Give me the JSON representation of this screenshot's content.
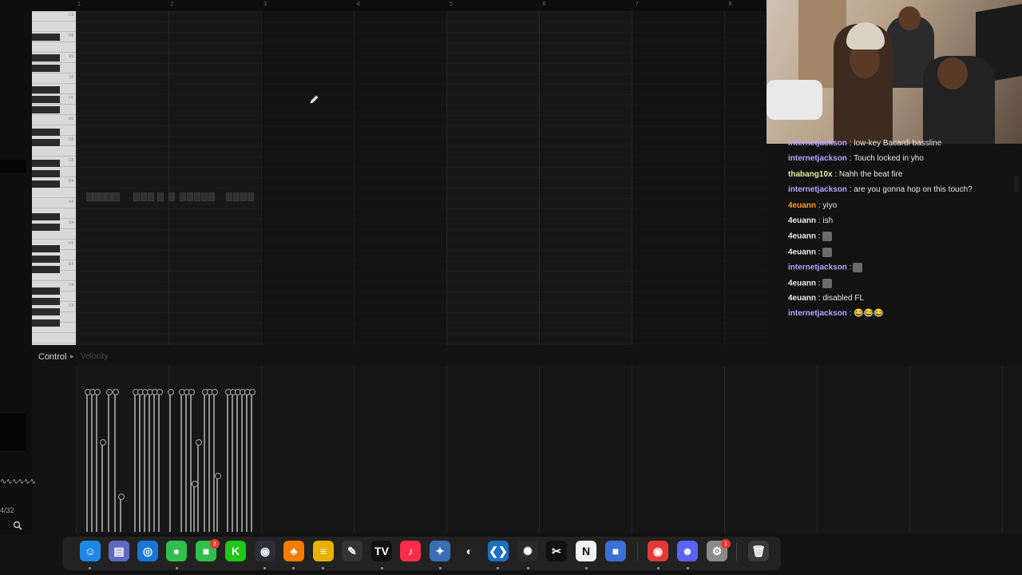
{
  "ruler": {
    "bars": [
      "1",
      "2",
      "3",
      "4",
      "5",
      "6",
      "7",
      "8"
    ]
  },
  "keyboard": {
    "labels": [
      "C6",
      "B5",
      "A5",
      "G5",
      "F5",
      "E5",
      "D5",
      "C5",
      "B4",
      "A4",
      "G4",
      "F4",
      "E4",
      "D4",
      "C4"
    ]
  },
  "control": {
    "label": "Control",
    "velocity_label": "Velocity"
  },
  "left_rail": {
    "time_signature": "4/32"
  },
  "chat": {
    "messages": [
      {
        "user": "internetjackson",
        "user_color": "#b9a6ff",
        "text": ": low-key Bacardi bassline"
      },
      {
        "user": "internetjackson",
        "user_color": "#b9a6ff",
        "text": ": Touch locked in yho"
      },
      {
        "user": "thabang10x",
        "user_color": "#d7f2a0",
        "text": ": Nahh the beat fire"
      },
      {
        "user": "internetjackson",
        "user_color": "#b9a6ff",
        "text": ": are you gonna hop on this touch?"
      },
      {
        "user": "4euann",
        "user_color": "#ff9f1a",
        "text": ": yiyo"
      },
      {
        "user": "4euann",
        "user_color": "#e9e9e9",
        "text": ": ish"
      },
      {
        "user": "4euann",
        "user_color": "#e9e9e9",
        "text": ":",
        "emote": "emote-icon"
      },
      {
        "user": "4euann",
        "user_color": "#e9e9e9",
        "text": ":",
        "emote": "emote-icon"
      },
      {
        "user": "internetjackson",
        "user_color": "#b9a6ff",
        "text": ":",
        "emote": "emote-icon"
      },
      {
        "user": "4euann",
        "user_color": "#e9e9e9",
        "text": ":",
        "emote": "emote-icon"
      },
      {
        "user": "4euann",
        "user_color": "#e9e9e9",
        "text": ": disabled FL"
      },
      {
        "user": "internetjackson",
        "user_color": "#b9a6ff",
        "text": ": 😂😂😂"
      }
    ]
  },
  "dock": {
    "apps": [
      {
        "name": "finder-icon",
        "glyph": "☺",
        "color": "#1e88e5"
      },
      {
        "name": "files-icon",
        "glyph": "▤",
        "color": "#5c6bc0"
      },
      {
        "name": "safari-icon",
        "glyph": "◎",
        "color": "#1976d2"
      },
      {
        "name": "messages-icon",
        "glyph": "●",
        "color": "#2fbf4a"
      },
      {
        "name": "facetime-icon",
        "glyph": "■",
        "color": "#2fbf4a",
        "badge": "3"
      },
      {
        "name": "kick-icon",
        "glyph": "K",
        "color": "#1fc716"
      },
      {
        "name": "obs-icon",
        "glyph": "◉",
        "color": "#2d2d3a"
      },
      {
        "name": "fl-studio-icon",
        "glyph": "♣",
        "color": "#f57c00"
      },
      {
        "name": "notes-icon",
        "glyph": "≡",
        "color": "#e8b300"
      },
      {
        "name": "pencil-app-icon",
        "glyph": "✎",
        "color": "#333333"
      },
      {
        "name": "tradingview-icon",
        "glyph": "TV",
        "color": "#111111"
      },
      {
        "name": "music-icon",
        "glyph": "♪",
        "color": "#fa2d48"
      },
      {
        "name": "davinci-icon",
        "glyph": "✦",
        "color": "#3a6db5"
      },
      {
        "name": "github-icon",
        "glyph": "◐",
        "color": "#222222"
      },
      {
        "name": "vscode-icon",
        "glyph": "❮❯",
        "color": "#1f6fbf"
      },
      {
        "name": "chatgpt-icon",
        "glyph": "✺",
        "color": "#2a2a2a"
      },
      {
        "name": "capcut-icon",
        "glyph": "✂",
        "color": "#111111"
      },
      {
        "name": "notion-icon",
        "glyph": "N",
        "color": "#f2f2f2"
      },
      {
        "name": "roblox-icon",
        "glyph": "■",
        "color": "#3b6fd8"
      },
      {
        "name": "chrome-icon",
        "glyph": "◉",
        "color": "#e53935"
      },
      {
        "name": "discord-icon",
        "glyph": "☻",
        "color": "#5865f2"
      },
      {
        "name": "settings-icon",
        "glyph": "⚙",
        "color": "#8a8a8a",
        "badge": "1"
      },
      {
        "name": "trash-icon",
        "glyph": "🗑",
        "color": "#3a3a3a"
      }
    ]
  }
}
